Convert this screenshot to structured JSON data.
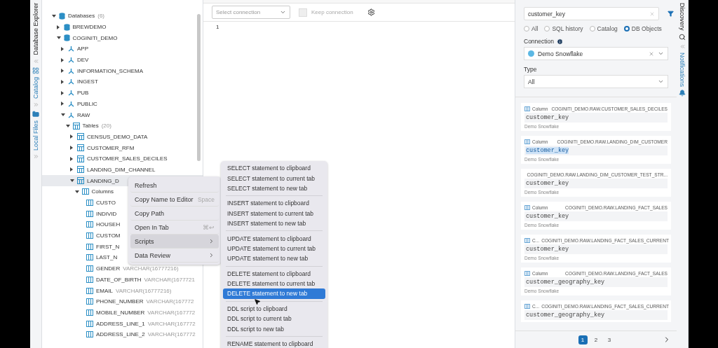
{
  "left_tabs": [
    {
      "label": "Database Explorer",
      "selected": true
    },
    {
      "label": "Catalog",
      "selected": false
    },
    {
      "label": "Local Files",
      "selected": false
    }
  ],
  "tree": [
    {
      "label": "Databases",
      "count": "(6)",
      "kind": "database",
      "expanded": true,
      "children": [
        {
          "label": "BREWDEMO",
          "kind": "database",
          "expanded": false
        },
        {
          "label": "COGINITI_DEMO",
          "kind": "database",
          "expanded": true,
          "children": [
            {
              "label": "APP",
              "kind": "schema",
              "expanded": false
            },
            {
              "label": "DEV",
              "kind": "schema",
              "expanded": false
            },
            {
              "label": "INFORMATION_SCHEMA",
              "kind": "schema",
              "expanded": false
            },
            {
              "label": "INGEST",
              "kind": "schema",
              "expanded": false
            },
            {
              "label": "PUB",
              "kind": "schema",
              "expanded": false
            },
            {
              "label": "PUBLIC",
              "kind": "schema",
              "expanded": false
            },
            {
              "label": "RAW",
              "kind": "schema",
              "expanded": true,
              "children": [
                {
                  "label": "Tables",
                  "count": "(20)",
                  "kind": "table",
                  "expanded": true,
                  "children": [
                    {
                      "label": "CENSUS_DEMO_DATA",
                      "kind": "table",
                      "expanded": false
                    },
                    {
                      "label": "CUSTOMER_RFM",
                      "kind": "table",
                      "expanded": false
                    },
                    {
                      "label": "CUSTOMER_SALES_DECILES",
                      "kind": "table",
                      "expanded": false
                    },
                    {
                      "label": "LANDING_DIM_CHANNEL",
                      "kind": "table",
                      "expanded": false
                    },
                    {
                      "label": "LANDING_D",
                      "kind": "table",
                      "expanded": true,
                      "selected": true,
                      "children": [
                        {
                          "label": "Columns",
                          "kind": "columns",
                          "expanded": true,
                          "children": [
                            {
                              "label": "CUSTO",
                              "kind": "column"
                            },
                            {
                              "label": "INDIVID",
                              "kind": "column"
                            },
                            {
                              "label": "HOUSEH",
                              "kind": "column"
                            },
                            {
                              "label": "CUSTOM",
                              "kind": "column"
                            },
                            {
                              "label": "FIRST_N",
                              "kind": "column"
                            },
                            {
                              "label": "LAST_N",
                              "kind": "column"
                            },
                            {
                              "label": "GENDER",
                              "type": "VARCHAR(16777216)",
                              "kind": "column"
                            },
                            {
                              "label": "DATE_OF_BIRTH",
                              "type": "VARCHAR(1677721",
                              "kind": "column"
                            },
                            {
                              "label": "EMAIL",
                              "type": "VARCHAR(16777216)",
                              "kind": "column"
                            },
                            {
                              "label": "PHONE_NUMBER",
                              "type": "VARCHAR(167772",
                              "kind": "column"
                            },
                            {
                              "label": "MOBILE_NUMBER",
                              "type": "VARCHAR(167772",
                              "kind": "column"
                            },
                            {
                              "label": "ADDRESS_LINE_1",
                              "type": "VARCHAR(167772",
                              "kind": "column"
                            },
                            {
                              "label": "ADDRESS_LINE_2",
                              "type": "VARCHAR(167772",
                              "kind": "column"
                            }
                          ]
                        }
                      ]
                    }
                  ]
                }
              ]
            }
          ]
        }
      ]
    }
  ],
  "editor": {
    "connection_placeholder": "Select connection",
    "keep_connection": {
      "label": "Keep connection",
      "checked": false,
      "disabled": true
    },
    "line_numbers": [
      "1"
    ]
  },
  "context_menu": [
    {
      "label": "Refresh",
      "kind": "item",
      "selected": false
    },
    {
      "label": "Copy Name to Editor",
      "shortcut": "Space",
      "kind": "item",
      "selected": false
    },
    {
      "label": "Copy Path",
      "kind": "item",
      "selected": false
    },
    {
      "label": "Open In Tab",
      "shortcut": "⌘↩",
      "kind": "item",
      "selected": false
    },
    {
      "label": "Scripts",
      "kind": "submenu",
      "selected": true
    },
    {
      "label": "Data Review",
      "kind": "submenu",
      "selected": false
    }
  ],
  "scripts_submenu": [
    [
      {
        "label": "SELECT statement to clipboard",
        "selected": false
      },
      {
        "label": "SELECT statement to current tab",
        "selected": false
      },
      {
        "label": "SELECT statement to new tab",
        "selected": false
      }
    ],
    [
      {
        "label": "INSERT statement to clipboard",
        "selected": false
      },
      {
        "label": "INSERT statement to current tab",
        "selected": false
      },
      {
        "label": "INSERT statement to new tab",
        "selected": false
      }
    ],
    [
      {
        "label": "UPDATE statement to clipboard",
        "selected": false
      },
      {
        "label": "UPDATE statement to current tab",
        "selected": false
      },
      {
        "label": "UPDATE statement to new tab",
        "selected": false
      }
    ],
    [
      {
        "label": "DELETE statement to clipboard",
        "selected": false
      },
      {
        "label": "DELETE statement to current tab",
        "selected": false
      },
      {
        "label": "DELETE statement to new tab",
        "selected": true
      }
    ],
    [
      {
        "label": "DDL script to clipboard",
        "selected": false
      },
      {
        "label": "DDL script to current tab",
        "selected": false
      },
      {
        "label": "DDL script to new tab",
        "selected": false
      }
    ],
    [
      {
        "label": "RENAME statement to clipboard",
        "selected": false
      }
    ]
  ],
  "discovery": {
    "search": "customer_key",
    "scopes": [
      {
        "label": "All",
        "selected": false
      },
      {
        "label": "SQL history",
        "selected": false
      },
      {
        "label": "Catalog",
        "selected": false
      },
      {
        "label": "DB Objects",
        "selected": true
      }
    ],
    "connection_label": "Connection",
    "connection": "Demo Snowflake",
    "type_label": "Type",
    "type": "All",
    "results": [
      {
        "kind": "Column",
        "path": "COGINITI_DEMO.RAW.CUSTOMER_SALES_DECILES",
        "name": "customer_key",
        "connection": "Demo Snowflake",
        "highlighted": false
      },
      {
        "kind": "Column",
        "path": "COGINITI_DEMO.RAW.LANDING_DIM_CUSTOMER",
        "name": "customer_key",
        "connection": "Demo Snowflake",
        "highlighted": true
      },
      {
        "path": "COGINITI_DEMO.RAW.LANDING_DIM_CUSTOMER_TEST_STR...",
        "name": "customer_key",
        "connection": "Demo Snowflake",
        "highlighted": false
      },
      {
        "kind": "Column",
        "path": "COGINITI_DEMO.RAW.LANDING_FACT_SALES",
        "name": "customer_key",
        "connection": "Demo Snowflake",
        "highlighted": false
      },
      {
        "kind": "C...",
        "path": "COGINITI_DEMO.RAW.LANDING_FACT_SALES_CURRENT",
        "name": "customer_key",
        "connection": "Demo Snowflake",
        "highlighted": false
      },
      {
        "kind": "Column",
        "path": "COGINITI_DEMO.RAW.LANDING_FACT_SALES",
        "name": "customer_geography_key",
        "connection": "Demo Snowflake",
        "highlighted": false
      },
      {
        "kind": "C...",
        "path": "COGINITI_DEMO.RAW.LANDING_FACT_SALES_CURRENT",
        "name": "customer_geography_key",
        "highlighted": false
      }
    ],
    "pages": [
      {
        "label": "1",
        "selected": true
      },
      {
        "label": "2",
        "selected": false
      },
      {
        "label": "3",
        "selected": false
      }
    ]
  },
  "right_tabs": [
    {
      "label": "Discovery",
      "selected": true
    },
    {
      "label": "Notifications",
      "selected": false
    }
  ]
}
